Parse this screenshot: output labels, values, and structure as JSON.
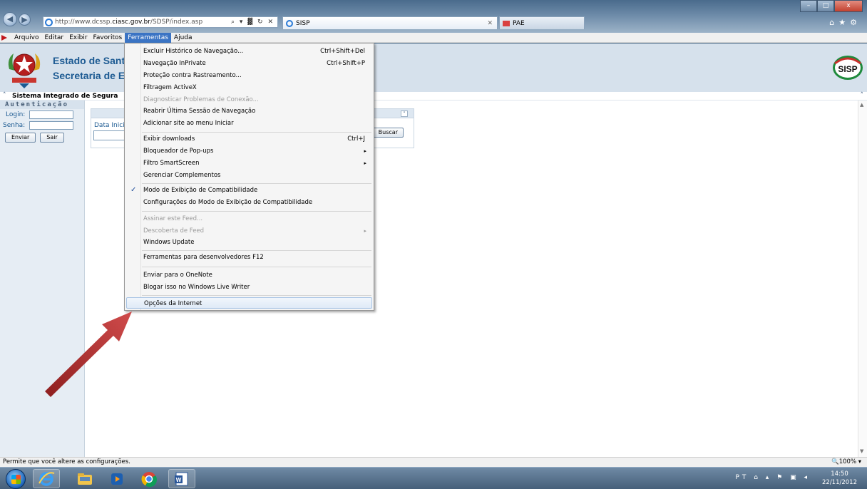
{
  "browser": {
    "address_url_prefix": "http://www.dcssp.",
    "address_url_domain": "ciasc.gov.br",
    "address_url_suffix": "/SDSP/index.asp",
    "address_tools": "⌕ ▾ ▓ ↻ ✕",
    "tabs": [
      {
        "label": "SISP",
        "close": "✕"
      },
      {
        "label": "PAE"
      }
    ],
    "window_controls": {
      "minimize": "–",
      "maximize": "□",
      "close": "x"
    },
    "right_icons": "⌂★⚙"
  },
  "menubar": {
    "items": [
      "Arquivo",
      "Editar",
      "Exibir",
      "Favoritos",
      "Ferramentas",
      "Ajuda"
    ],
    "active": "Ferramentas"
  },
  "page": {
    "banner_line1": "Estado de Sant",
    "banner_line2": "Secretaria de E",
    "logo_text": "SISP",
    "system_title": "Sistema Integrado de Segura",
    "auth_header": "Autenticação",
    "login_label": "Login:",
    "password_label": "Senha:",
    "enter_button": "Enviar",
    "exit_button": "Sair",
    "date_label": "Data Inici",
    "search_button": "Buscar",
    "collapse_glyph": "«"
  },
  "dropdown": {
    "items": [
      {
        "label": "Excluir Histórico de Navegação...",
        "shortcut": "Ctrl+Shift+Del"
      },
      {
        "label": "Navegação InPrivate",
        "shortcut": "Ctrl+Shift+P"
      },
      {
        "label": "Proteção contra Rastreamento..."
      },
      {
        "label": "Filtragem ActiveX"
      },
      {
        "label": "Diagnosticar Problemas de Conexão...",
        "disabled": true
      },
      {
        "label": "Reabrir Última Sessão de Navegação"
      },
      {
        "label": "Adicionar site ao menu Iniciar"
      },
      {
        "label": "Exibir downloads",
        "shortcut": "Ctrl+J"
      },
      {
        "label": "Bloqueador de Pop-ups",
        "submenu": true
      },
      {
        "label": "Filtro SmartScreen",
        "submenu": true
      },
      {
        "label": "Gerenciar Complementos"
      },
      {
        "label": "Modo de Exibição de Compatibilidade",
        "checked": true
      },
      {
        "label": "Configurações do Modo de Exibição de Compatibilidade"
      },
      {
        "label": "Assinar este Feed...",
        "disabled": true
      },
      {
        "label": "Descoberta de Feed",
        "disabled": true,
        "submenu": true
      },
      {
        "label": "Windows Update"
      },
      {
        "label": "Ferramentas para desenvolvedores F12"
      },
      {
        "label": "Enviar para o OneNote"
      },
      {
        "label": "Blogar isso no Windows Live Writer"
      },
      {
        "label": "Opções da Internet",
        "highlighted": true
      }
    ],
    "check_glyph": "✓",
    "submenu_glyph": "▸"
  },
  "status": {
    "text": "Permite que você altere as configurações.",
    "zoom": "🔍100%  ▾"
  },
  "taskbar": {
    "tray": "PT ⌂ ▴ ⚑ ▣ ◂",
    "time": "14:50",
    "date": "22/11/2012"
  },
  "colors": {
    "annotation_arrow": "#c0392b",
    "menu_highlight": "#3b74c4",
    "banner_text": "#1c5a92"
  }
}
